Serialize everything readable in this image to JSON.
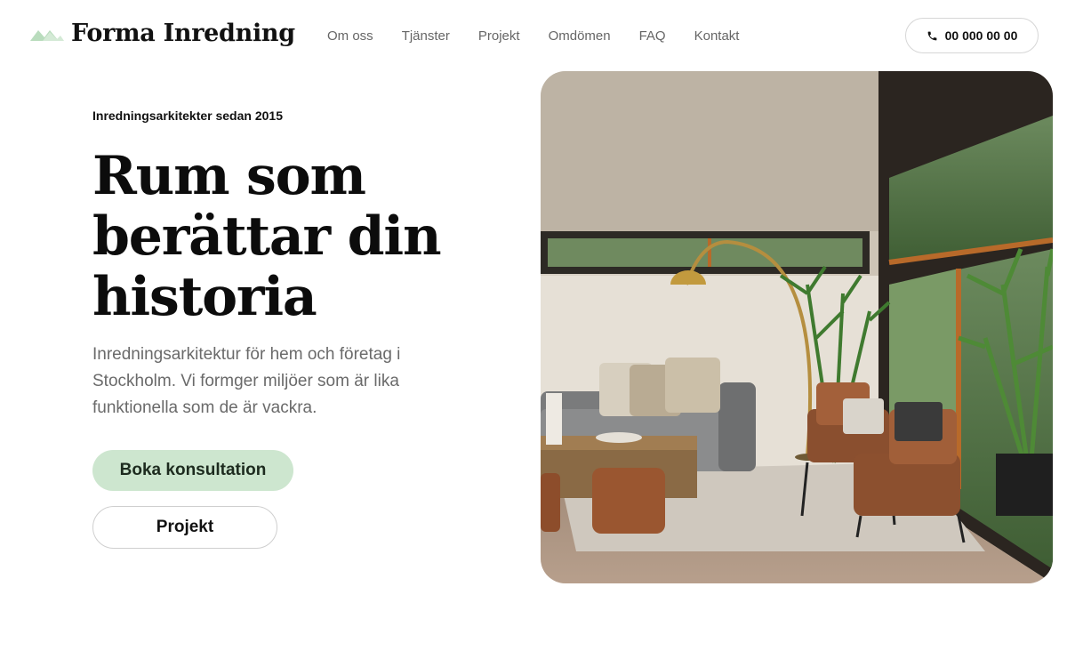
{
  "brand": {
    "name": "Forma Inredning",
    "logo_icon": "mountains-icon",
    "accent": "#cde6cf"
  },
  "nav": {
    "items": [
      "Om oss",
      "Tjänster",
      "Projekt",
      "Omdömen",
      "FAQ",
      "Kontakt"
    ]
  },
  "header": {
    "phone_icon": "phone-icon",
    "phone_number": "00 000 00 00"
  },
  "hero": {
    "eyebrow": "Inredningsarkitekter sedan 2015",
    "headline_lines": [
      "Rum som",
      "berättar din",
      "historia"
    ],
    "lead": "Inredningsarkitektur för hem och företag i Stockholm. Vi formger miljöer som är lika funktionella som de är vackra.",
    "primary_cta": "Boka konsultation",
    "secondary_cta": "Projekt",
    "image": "living-room-photo"
  },
  "colors": {
    "primary_button_bg": "#cde6cf",
    "text": "#111111",
    "muted_text": "#6a6a6a"
  }
}
